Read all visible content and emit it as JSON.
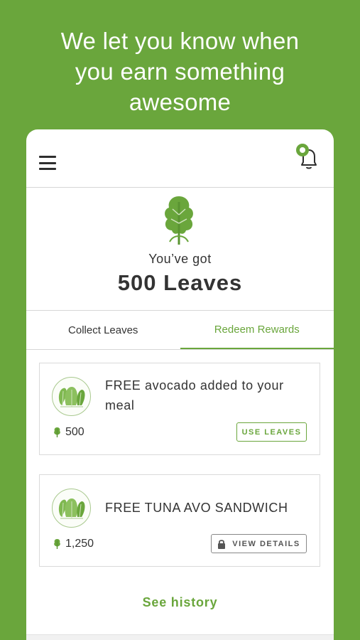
{
  "headline": {
    "line1": "We let you know when",
    "line2": "you earn something",
    "line3": "awesome"
  },
  "header": {
    "menu_icon": "hamburger-menu-icon",
    "notification_icon": "bell-icon",
    "notification_dot_color": "#6aa63c"
  },
  "summary": {
    "label": "You’ve got",
    "balance": "500 Leaves",
    "logo_icon": "kale-leaf-icon"
  },
  "tabs": [
    {
      "label": "Collect Leaves",
      "active": false
    },
    {
      "label": "Redeem Rewards",
      "active": true
    }
  ],
  "rewards": [
    {
      "title": "FREE avocado added to your meal",
      "cost": "500",
      "action": "USE LEAVES",
      "icon": "salad-greens-icon"
    },
    {
      "title": "FREE TUNA AVO SANDWICH",
      "cost": "1,250",
      "action": "VIEW DETAILS",
      "icon": "salad-greens-icon",
      "locked": true
    }
  ],
  "footer": {
    "history_link": "See history"
  },
  "colors": {
    "brand": "#6aa63c",
    "text": "#333333",
    "border": "#dadada"
  }
}
